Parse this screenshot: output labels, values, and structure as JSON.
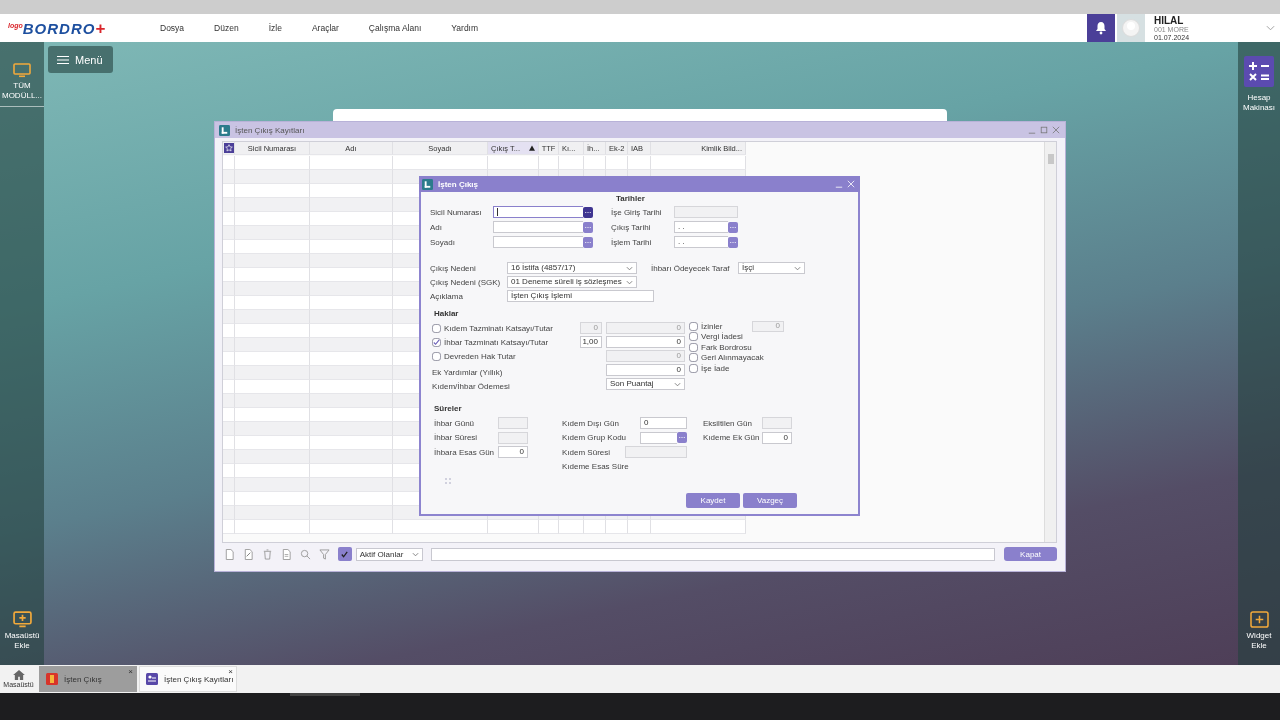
{
  "header": {
    "logo": {
      "brand": "logo",
      "product": "BORDRO",
      "mark": "+"
    },
    "menus": [
      "Dosya",
      "Düzen",
      "İzle",
      "Araçlar",
      "Çalışma Alanı",
      "Yardım"
    ],
    "user": {
      "name": "HILAL",
      "company": "001 MORE",
      "date": "01.07.2024"
    }
  },
  "left_rail": {
    "top": "TÜM MODÜLL...",
    "bottom": "Masaüstü Ekle"
  },
  "right_rail": {
    "top": "Hesap Makinası",
    "bottom": "Widget Ekle"
  },
  "menu_button": "Menü",
  "records_window": {
    "title": "İşten Çıkış Kayıtları",
    "columns": [
      {
        "label": "Sicil Numarası",
        "sorted": false
      },
      {
        "label": "Adı",
        "sorted": false
      },
      {
        "label": "Soyadı",
        "sorted": false
      },
      {
        "label": "Çıkış T...",
        "sorted": true
      },
      {
        "label": "TTF",
        "sorted": false
      },
      {
        "label": "Kı...",
        "sorted": false
      },
      {
        "label": "İh...",
        "sorted": false
      },
      {
        "label": "Ek-2",
        "sorted": false
      },
      {
        "label": "IAB",
        "sorted": false
      },
      {
        "label": "Kimlik Bild...",
        "sorted": false
      }
    ],
    "filter": "Aktif Olanlar",
    "close_button": "Kapat"
  },
  "dialog": {
    "title": "İşten Çıkış",
    "ident": [
      {
        "label": "Sicil Numarası",
        "field": {
          "kind": "lookup",
          "disabled": false,
          "focused": true
        }
      },
      {
        "label": "Adı",
        "field": {
          "kind": "lookup",
          "disabled": false,
          "focused": false
        }
      },
      {
        "label": "Soyadı",
        "field": {
          "kind": "lookup",
          "disabled": false,
          "focused": false
        }
      }
    ],
    "dates_title": "Tarihler",
    "dates": [
      {
        "label": "İşe Giriş Tarihi",
        "field": {
          "kind": "input",
          "disabled": true
        }
      },
      {
        "label": "Çıkış Tarihi",
        "field": {
          "kind": "lookup",
          "value": ". .",
          "disabled": false,
          "focused": false
        }
      },
      {
        "label": "İşlem Tarihi",
        "field": {
          "kind": "lookup",
          "value": ". .",
          "disabled": false,
          "focused": false
        }
      }
    ],
    "reason": [
      {
        "label": "Çıkış Nedeni",
        "field": {
          "kind": "select",
          "value": "16 İstifa (4857/17)",
          "disabled": false
        }
      },
      {
        "label": "Çıkış Nedeni (SGK)",
        "field": {
          "kind": "select",
          "value": "01 Deneme süreli iş sözleşmes",
          "disabled": false
        }
      },
      {
        "label": "Açıklama",
        "field": {
          "kind": "input",
          "value": "İşten Çıkış İşlemi",
          "disabled": false
        }
      }
    ],
    "payer": {
      "label": "İhbarı Ödeyecek Taraf",
      "field": {
        "kind": "select",
        "value": "İşçi",
        "disabled": false
      }
    },
    "rights_title": "Haklar",
    "rights": [
      {
        "kind": "checkbox",
        "label": "Kıdem Tazminatı Katsayı/Tutar",
        "checked": false,
        "rate": {
          "kind": "input",
          "value": "0",
          "disabled": true
        },
        "amount": {
          "kind": "input",
          "value": "0",
          "disabled": true
        }
      },
      {
        "kind": "checkbox",
        "label": "İhbar Tazminatı Katsayı/Tutar",
        "checked": true,
        "rate": {
          "kind": "input",
          "value": "1,00",
          "disabled": false
        },
        "amount": {
          "kind": "input",
          "value": "0",
          "disabled": false
        }
      },
      {
        "kind": "checkbox",
        "label": "Devreden Hak Tutar",
        "checked": false,
        "amount": {
          "kind": "input",
          "value": "0",
          "disabled": true
        }
      },
      {
        "kind": "label",
        "label": "Ek Yardımlar (Yıllık)",
        "amount": {
          "kind": "input",
          "value": "0",
          "disabled": false
        }
      },
      {
        "kind": "label",
        "label": "Kıdem/İhbar Ödemesi",
        "amount": {
          "kind": "select",
          "value": "Son Puantaj",
          "disabled": false
        }
      }
    ],
    "options": [
      {
        "label": "İzinler",
        "checked": false,
        "field": {
          "kind": "input",
          "value": "0",
          "disabled": true
        }
      },
      {
        "label": "Vergi İadesi",
        "checked": false
      },
      {
        "label": "Fark Bordrosu",
        "checked": false
      },
      {
        "label": "Geri Alınmayacak",
        "checked": false
      },
      {
        "label": "İşe İade",
        "checked": false
      }
    ],
    "durations_title": "Süreler",
    "duration_columns": [
      {
        "items": [
          {
            "label": "İhbar Günü",
            "field": {
              "kind": "input",
              "disabled": true
            }
          },
          {
            "label": "İhbar Süresi",
            "field": {
              "kind": "input",
              "disabled": true
            }
          },
          {
            "label": "İhbara Esas Gün",
            "field": {
              "kind": "input",
              "value": "0",
              "disabled": false
            }
          }
        ]
      },
      {
        "items": [
          {
            "label": "Kıdem Dışı Gün",
            "field": {
              "kind": "input",
              "value": "0",
              "disabled": false
            }
          },
          {
            "label": "Kıdem Grup Kodu",
            "field": {
              "kind": "lookup",
              "disabled": false,
              "focused": false
            }
          },
          {
            "label": "Kıdem Süresi",
            "field": {
              "kind": "input",
              "disabled": true
            }
          },
          {
            "label": "Kıdeme Esas Süre"
          }
        ]
      },
      {
        "items": [
          {
            "label": "Eksiltilen Gün",
            "field": {
              "kind": "input",
              "disabled": true
            }
          },
          {
            "label": "Kıdeme Ek Gün",
            "field": {
              "kind": "input",
              "value": "0",
              "disabled": false
            }
          }
        ]
      }
    ],
    "buttons": [
      "Kaydet",
      "Vazgeç"
    ]
  },
  "taskbar": {
    "home": "Masaüstü",
    "tabs": [
      {
        "label": "İşten Çıkış",
        "selected": true,
        "close": "×"
      },
      {
        "label": "İşten Çıkış Kayıtları",
        "selected": false,
        "close": "×"
      }
    ]
  }
}
